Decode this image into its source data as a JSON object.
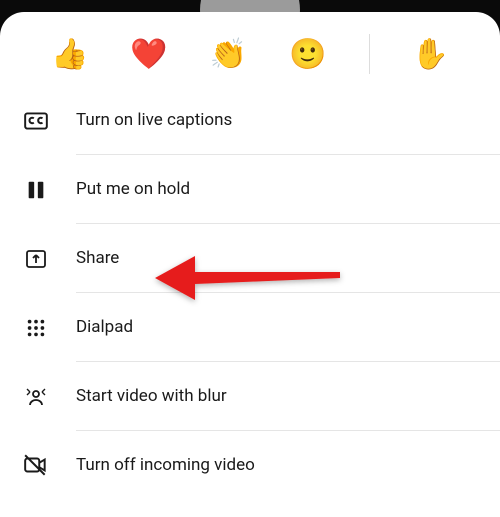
{
  "reactions": {
    "thumbs_up": "👍",
    "heart": "❤️",
    "clap": "👏",
    "smile": "🙂",
    "raise_hand": "✋"
  },
  "menu": {
    "captions": "Turn on live captions",
    "hold": "Put me on hold",
    "share": "Share",
    "dialpad": "Dialpad",
    "blur": "Start video with blur",
    "incoming_off": "Turn off incoming video"
  }
}
